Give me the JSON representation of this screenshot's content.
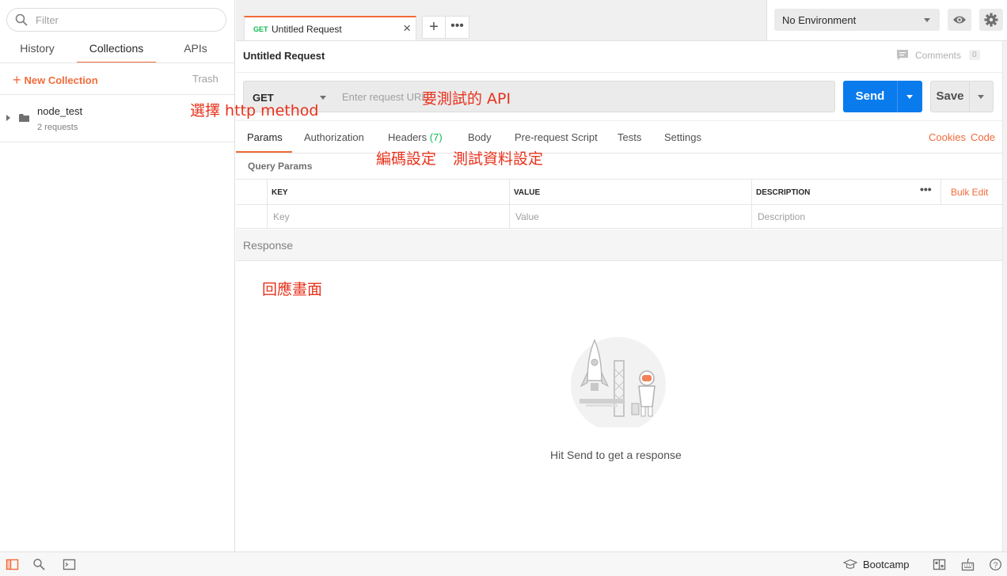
{
  "sidebar": {
    "filter_placeholder": "Filter",
    "tabs": [
      {
        "label": "History"
      },
      {
        "label": "Collections"
      },
      {
        "label": "APIs"
      }
    ],
    "new_collection_label": "New Collection",
    "trash_label": "Trash",
    "collections": [
      {
        "name": "node_test",
        "count": "2 requests"
      }
    ]
  },
  "tabs": {
    "active": {
      "method": "GET",
      "title": "Untitled Request"
    }
  },
  "environment": {
    "selected": "No Environment"
  },
  "request": {
    "title": "Untitled Request",
    "comments_label": "Comments",
    "comments_count": "0",
    "method": "GET",
    "url_placeholder": "Enter request URL",
    "send_label": "Send",
    "save_label": "Save",
    "tabs": {
      "params": "Params",
      "authorization": "Authorization",
      "headers": "Headers",
      "headers_count": "(7)",
      "body": "Body",
      "prereq": "Pre-request Script",
      "tests": "Tests",
      "settings": "Settings"
    },
    "cookies_label": "Cookies",
    "code_label": "Code",
    "query_params_label": "Query Params",
    "table": {
      "headers": {
        "key": "KEY",
        "value": "VALUE",
        "description": "DESCRIPTION",
        "bulk_edit": "Bulk Edit"
      },
      "placeholders": {
        "key": "Key",
        "value": "Value",
        "description": "Description"
      }
    }
  },
  "response": {
    "label": "Response",
    "empty_text": "Hit Send to get a response"
  },
  "annotations": {
    "method": "選擇 http method",
    "url": "要測試的 API",
    "headers": "編碼設定",
    "body": "測試資料設定",
    "response": "回應畫面"
  },
  "statusbar": {
    "bootcamp_label": "Bootcamp"
  },
  "colors": {
    "accent": "#f26b3a",
    "send_blue": "#097bed",
    "get_green": "#0cbb52",
    "annotation_red": "#e8321c"
  }
}
